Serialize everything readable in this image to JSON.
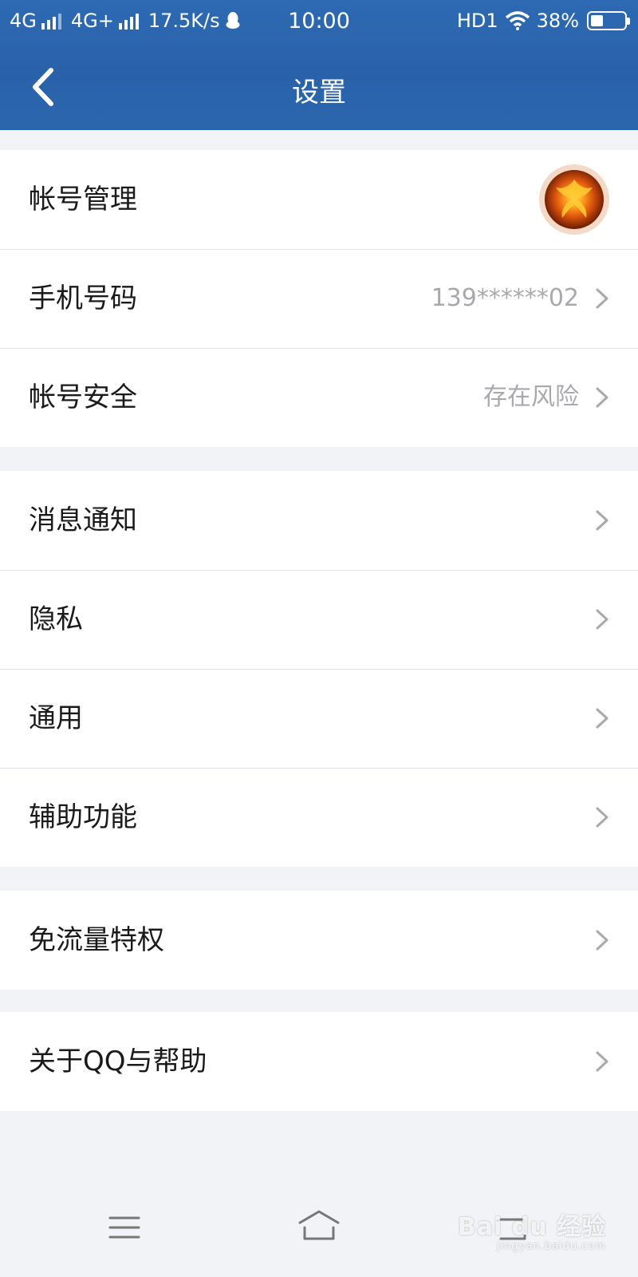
{
  "status_bar": {
    "network1": "4G",
    "network2": "4G+",
    "speed": "17.5K/s",
    "time": "10:00",
    "hd": "HD1",
    "battery": "38%",
    "battery_level": 0.38
  },
  "header": {
    "title": "设置"
  },
  "groups": [
    {
      "rows": [
        {
          "label": "帐号管理",
          "value": "",
          "avatar": true
        },
        {
          "label": "手机号码",
          "value": "139******02"
        },
        {
          "label": "帐号安全",
          "value": "存在风险"
        }
      ]
    },
    {
      "rows": [
        {
          "label": "消息通知",
          "value": ""
        },
        {
          "label": "隐私",
          "value": ""
        },
        {
          "label": "通用",
          "value": ""
        },
        {
          "label": "辅助功能",
          "value": ""
        }
      ]
    },
    {
      "rows": [
        {
          "label": "免流量特权",
          "value": ""
        }
      ]
    },
    {
      "rows": [
        {
          "label": "关于QQ与帮助",
          "value": ""
        }
      ]
    }
  ],
  "nav": {
    "icons": [
      "menu-icon",
      "home-icon",
      "back-icon"
    ]
  },
  "watermark": {
    "text": "Bai du 经验",
    "sub": "jingyan.baidu.com"
  },
  "colors": {
    "header": "#2b65ad",
    "background": "#f1f3f7",
    "secondary_text": "#a9a9ad"
  }
}
